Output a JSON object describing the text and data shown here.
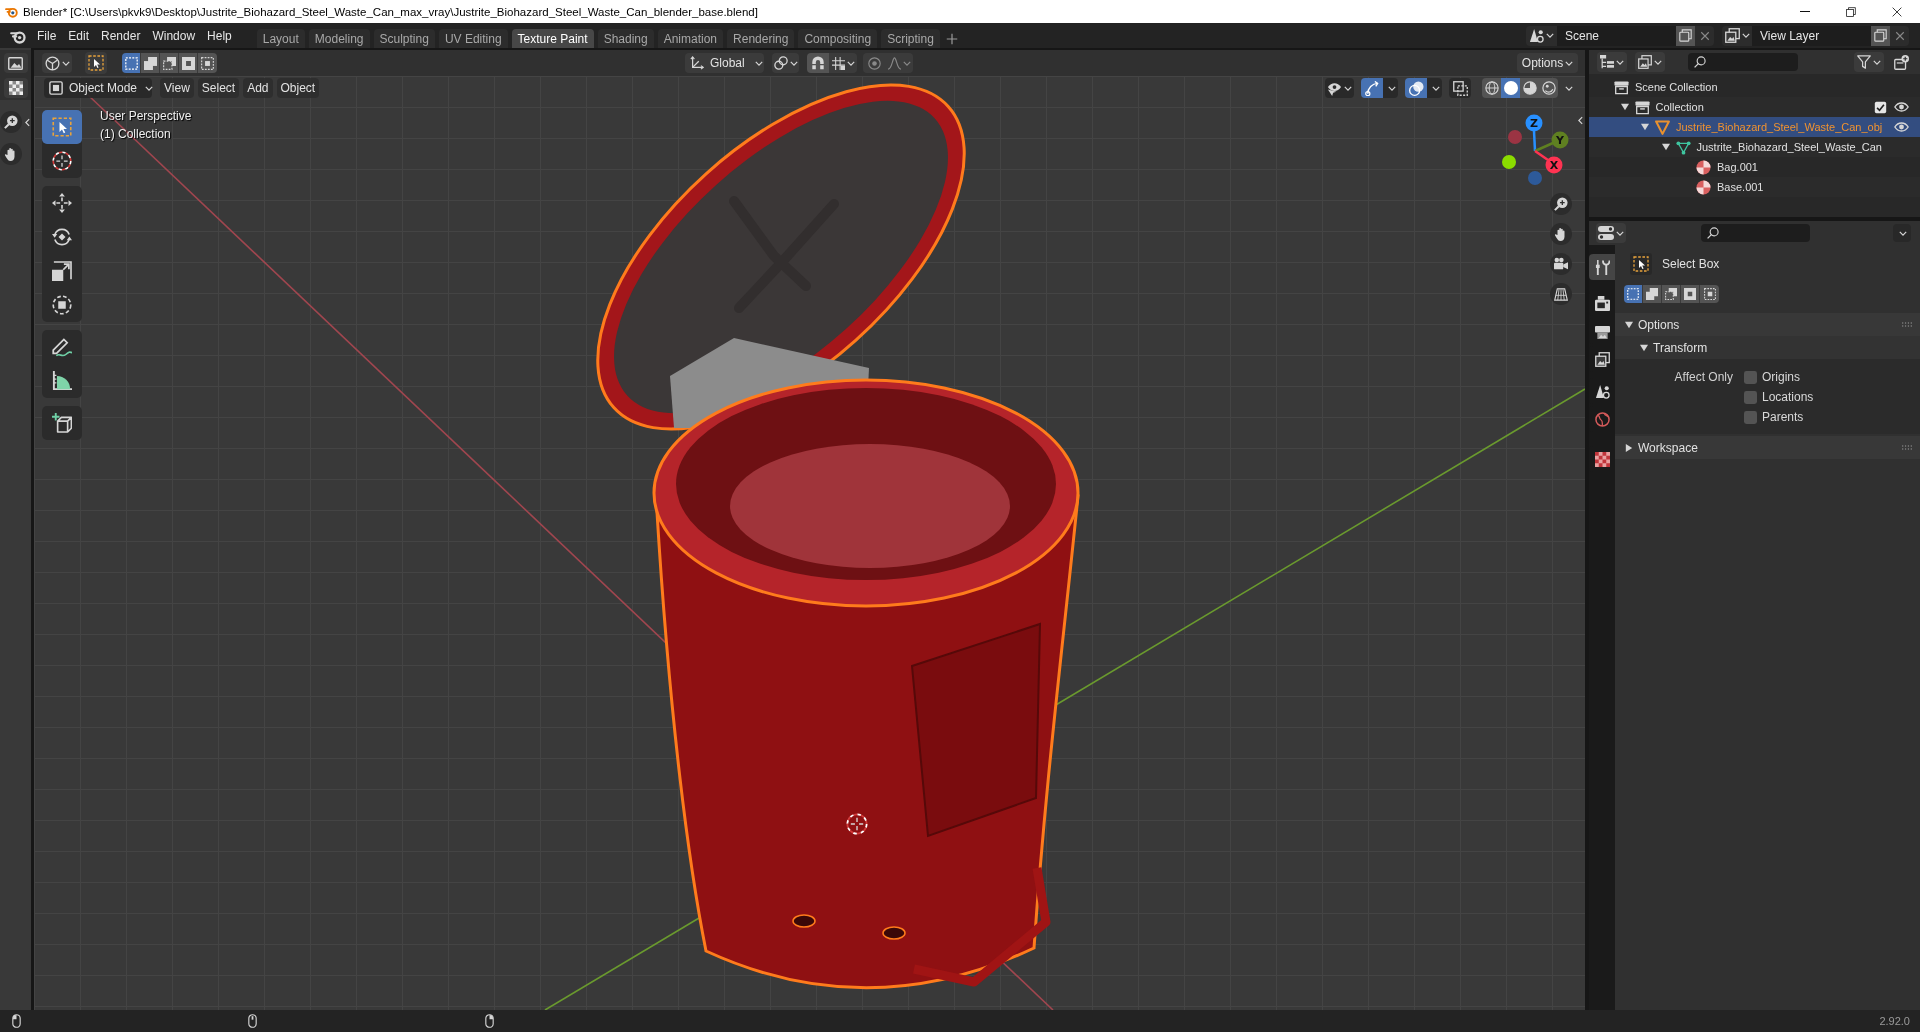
{
  "window": {
    "title": "Blender* [C:\\Users\\pkvk9\\Desktop\\Justrite_Biohazard_Steel_Waste_Can_max_vray\\Justrite_Biohazard_Steel_Waste_Can_blender_base.blend]"
  },
  "menu": [
    "File",
    "Edit",
    "Render",
    "Window",
    "Help"
  ],
  "workspaces": [
    {
      "label": "Layout",
      "selected": false
    },
    {
      "label": "Modeling",
      "selected": false
    },
    {
      "label": "Sculpting",
      "selected": false
    },
    {
      "label": "UV Editing",
      "selected": false
    },
    {
      "label": "Texture Paint",
      "selected": true
    },
    {
      "label": "Shading",
      "selected": false
    },
    {
      "label": "Animation",
      "selected": false
    },
    {
      "label": "Rendering",
      "selected": false
    },
    {
      "label": "Compositing",
      "selected": false
    },
    {
      "label": "Scripting",
      "selected": false
    }
  ],
  "scene": {
    "name": "Scene"
  },
  "view_layer": {
    "name": "View Layer"
  },
  "viewport": {
    "tool_header": {
      "select_modes": [
        {
          "kind": "set",
          "selected": true
        },
        {
          "kind": "extend",
          "selected": false
        },
        {
          "kind": "subtract",
          "selected": false
        },
        {
          "kind": "invert",
          "selected": false
        },
        {
          "kind": "intersect",
          "selected": false
        }
      ],
      "orientation": "Global",
      "options": "Options"
    },
    "header": {
      "mode": "Object Mode",
      "menus": [
        "View",
        "Select",
        "Add",
        "Object"
      ],
      "toggles": [
        {
          "kind": "gizmos",
          "on": true
        },
        {
          "kind": "overlays",
          "on": true
        },
        {
          "kind": "xray",
          "on": false
        }
      ],
      "shading": [
        {
          "kind": "wireframe",
          "selected": false
        },
        {
          "kind": "solid",
          "selected": true
        },
        {
          "kind": "material",
          "selected": false
        },
        {
          "kind": "rendered",
          "selected": false
        }
      ]
    },
    "info": [
      "User Perspective",
      "(1) Collection"
    ],
    "tool_groups": [
      {
        "tools": [
          {
            "kind": "select_box",
            "selected": true
          },
          {
            "kind": "cursor",
            "selected": false
          }
        ]
      },
      {
        "tools": [
          {
            "kind": "move",
            "selected": false
          },
          {
            "kind": "rotate",
            "selected": false
          },
          {
            "kind": "scale",
            "selected": false
          },
          {
            "kind": "transform",
            "selected": false
          }
        ]
      },
      {
        "tools": [
          {
            "kind": "annotate",
            "selected": false
          },
          {
            "kind": "measure",
            "selected": false
          }
        ]
      },
      {
        "tools": [
          {
            "kind": "add_cube",
            "selected": false
          }
        ]
      }
    ],
    "axes": {
      "x": "X",
      "y": "Y",
      "z": "Z"
    }
  },
  "outliner": {
    "tree": [
      {
        "label": "Scene Collection",
        "kind": "scene_collection",
        "selected": false,
        "children": [
          {
            "label": "Collection",
            "kind": "collection",
            "selected": false,
            "expanded": true,
            "checked": true,
            "visible": true,
            "children": [
              {
                "label": "Justrite_Biohazard_Steel_Waste_Can_obj",
                "kind": "object",
                "selected": true,
                "expanded": true,
                "visible": true,
                "children": [
                  {
                    "label": "Justrite_Biohazard_Steel_Waste_Can",
                    "kind": "mesh",
                    "selected": false,
                    "expanded": true,
                    "children": [
                      {
                        "label": "Bag.001",
                        "kind": "material",
                        "selected": false
                      },
                      {
                        "label": "Base.001",
                        "kind": "material",
                        "selected": false
                      }
                    ]
                  }
                ]
              }
            ]
          }
        ]
      }
    ]
  },
  "properties": {
    "tabs": [
      {
        "kind": "tool",
        "selected": true
      },
      {
        "kind": "render",
        "selected": false
      },
      {
        "kind": "output",
        "selected": false
      },
      {
        "kind": "view_layer",
        "selected": false
      },
      {
        "kind": "scene",
        "selected": false
      },
      {
        "kind": "world",
        "selected": false
      },
      {
        "kind": "texture",
        "selected": false
      }
    ],
    "tool": {
      "name": "Select Box",
      "select_modes": [
        {
          "kind": "set",
          "selected": true
        },
        {
          "kind": "extend",
          "selected": false
        },
        {
          "kind": "subtract",
          "selected": false
        },
        {
          "kind": "invert",
          "selected": false
        },
        {
          "kind": "intersect",
          "selected": false
        }
      ]
    },
    "panels": [
      {
        "title": "Options",
        "expanded": true,
        "subpanels": [
          {
            "title": "Transform",
            "expanded": true,
            "label": "Affect Only",
            "options": [
              {
                "label": "Origins",
                "checked": false
              },
              {
                "label": "Locations",
                "checked": false
              },
              {
                "label": "Parents",
                "checked": false
              }
            ]
          }
        ]
      },
      {
        "title": "Workspace",
        "expanded": false
      }
    ]
  },
  "status_bar": {
    "version": "2.92.0"
  }
}
